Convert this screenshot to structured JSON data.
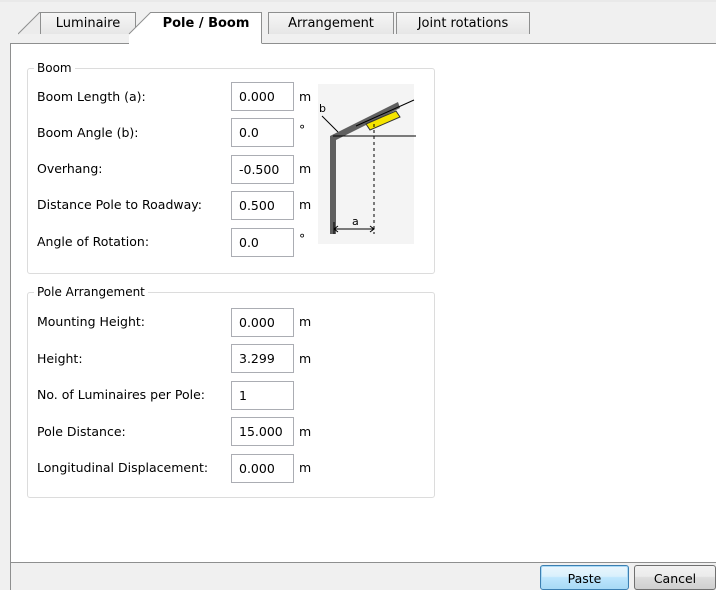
{
  "tabs": [
    {
      "label": "Luminaire",
      "active": false
    },
    {
      "label": "Pole / Boom",
      "active": true
    },
    {
      "label": "Arrangement",
      "active": false
    },
    {
      "label": "Joint rotations",
      "active": false
    }
  ],
  "boom": {
    "title": "Boom",
    "rows": [
      {
        "label": "Boom Length (a):",
        "value": "0.000",
        "unit": "m"
      },
      {
        "label": "Boom Angle (b):",
        "value": "0.0",
        "unit": "°"
      },
      {
        "label": "Overhang:",
        "value": "-0.500",
        "unit": "m"
      },
      {
        "label": "Distance Pole to Roadway:",
        "value": "0.500",
        "unit": "m"
      },
      {
        "label": "Angle of Rotation:",
        "value": "0.0",
        "unit": "°"
      }
    ],
    "diagram": {
      "label_b": "b",
      "label_a": "a",
      "luminaire_color": "#f5e400"
    }
  },
  "pole_arrangement": {
    "title": "Pole Arrangement",
    "rows": [
      {
        "label": "Mounting Height:",
        "value": "0.000",
        "unit": "m"
      },
      {
        "label": "Height:",
        "value": "3.299",
        "unit": "m"
      },
      {
        "label": "No. of Luminaires per Pole:",
        "value": "1",
        "unit": ""
      },
      {
        "label": "Pole Distance:",
        "value": "15.000",
        "unit": "m"
      },
      {
        "label": "Longitudinal Displacement:",
        "value": "0.000",
        "unit": "m"
      }
    ]
  },
  "buttons": {
    "paste": "Paste",
    "cancel": "Cancel"
  }
}
